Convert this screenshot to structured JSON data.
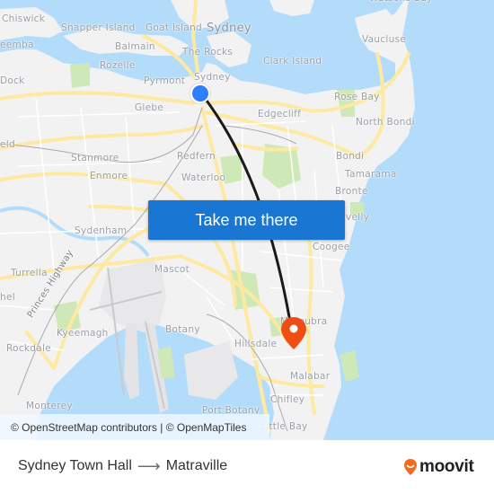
{
  "map": {
    "places": [
      {
        "id": "chiswick",
        "label": "Chiswick"
      },
      {
        "id": "snapper-island",
        "label": "Snapper Island"
      },
      {
        "id": "goat-island",
        "label": "Goat Island"
      },
      {
        "id": "sydney-cbd",
        "label": "Sydney"
      },
      {
        "id": "watsons-bay",
        "label": "Watsons Bay"
      },
      {
        "id": "vaucluse",
        "label": "Vaucluse"
      },
      {
        "id": "drummoyne",
        "label": "eemba"
      },
      {
        "id": "balmain",
        "label": "Balmain"
      },
      {
        "id": "the-rocks",
        "label": "The Rocks"
      },
      {
        "id": "clark-island",
        "label": "Clark Island"
      },
      {
        "id": "rozelle",
        "label": "Rozelle"
      },
      {
        "id": "dock",
        "label": "Dock"
      },
      {
        "id": "pyrmont",
        "label": "Pyrmont"
      },
      {
        "id": "sydney",
        "label": "Sydney"
      },
      {
        "id": "rose-bay",
        "label": "Rose Bay"
      },
      {
        "id": "glebe",
        "label": "Glebe"
      },
      {
        "id": "edgecliff",
        "label": "Edgecliff"
      },
      {
        "id": "north-bondi",
        "label": "North Bondi"
      },
      {
        "id": "field",
        "label": "eld"
      },
      {
        "id": "stanmore",
        "label": "Stanmore"
      },
      {
        "id": "redfern",
        "label": "Redfern"
      },
      {
        "id": "bondi",
        "label": "Bondi"
      },
      {
        "id": "tamarama",
        "label": "Tamarama"
      },
      {
        "id": "enmore",
        "label": "Enmore"
      },
      {
        "id": "waterloo",
        "label": "Waterloo"
      },
      {
        "id": "bronte",
        "label": "Bronte"
      },
      {
        "id": "clovelly",
        "label": "velly"
      },
      {
        "id": "sydenham",
        "label": "Sydenham"
      },
      {
        "id": "coogee",
        "label": "Coogee"
      },
      {
        "id": "turrella",
        "label": "Turrella"
      },
      {
        "id": "mascot",
        "label": "Mascot"
      },
      {
        "id": "bexley",
        "label": "hel"
      },
      {
        "id": "princes-highway",
        "label": "Princes Highway"
      },
      {
        "id": "maroubra",
        "label": "Maroubra"
      },
      {
        "id": "kyeemagh",
        "label": "Kyeemagh"
      },
      {
        "id": "botany",
        "label": "Botany"
      },
      {
        "id": "hillsdale",
        "label": "Hillsdale"
      },
      {
        "id": "rockdale",
        "label": "Rockdale"
      },
      {
        "id": "malabar",
        "label": "Malabar"
      },
      {
        "id": "chifley",
        "label": "Chifley"
      },
      {
        "id": "monterey",
        "label": "Monterey"
      },
      {
        "id": "port-botany",
        "label": "Port Botany"
      },
      {
        "id": "little-bay",
        "label": "Little Bay"
      }
    ],
    "cta_label": "Take me there",
    "attribution": "© OpenStreetMap contributors | © OpenMapTiles",
    "origin_marker": "origin-dot",
    "destination_marker": "destination-pin",
    "colors": {
      "water": "#b3dcfb",
      "land": "#f2f2f3",
      "road": "#fde9a0",
      "park": "#cfe8b8",
      "route": "#1a1a1a",
      "cta": "#1976d2",
      "origin": "#2d7ff9",
      "destination": "#f04d14",
      "moovit": "#f46a1e"
    }
  },
  "footer": {
    "origin": "Sydney Town Hall",
    "arrow": "⟶",
    "destination": "Matraville",
    "brand": "moovit"
  }
}
